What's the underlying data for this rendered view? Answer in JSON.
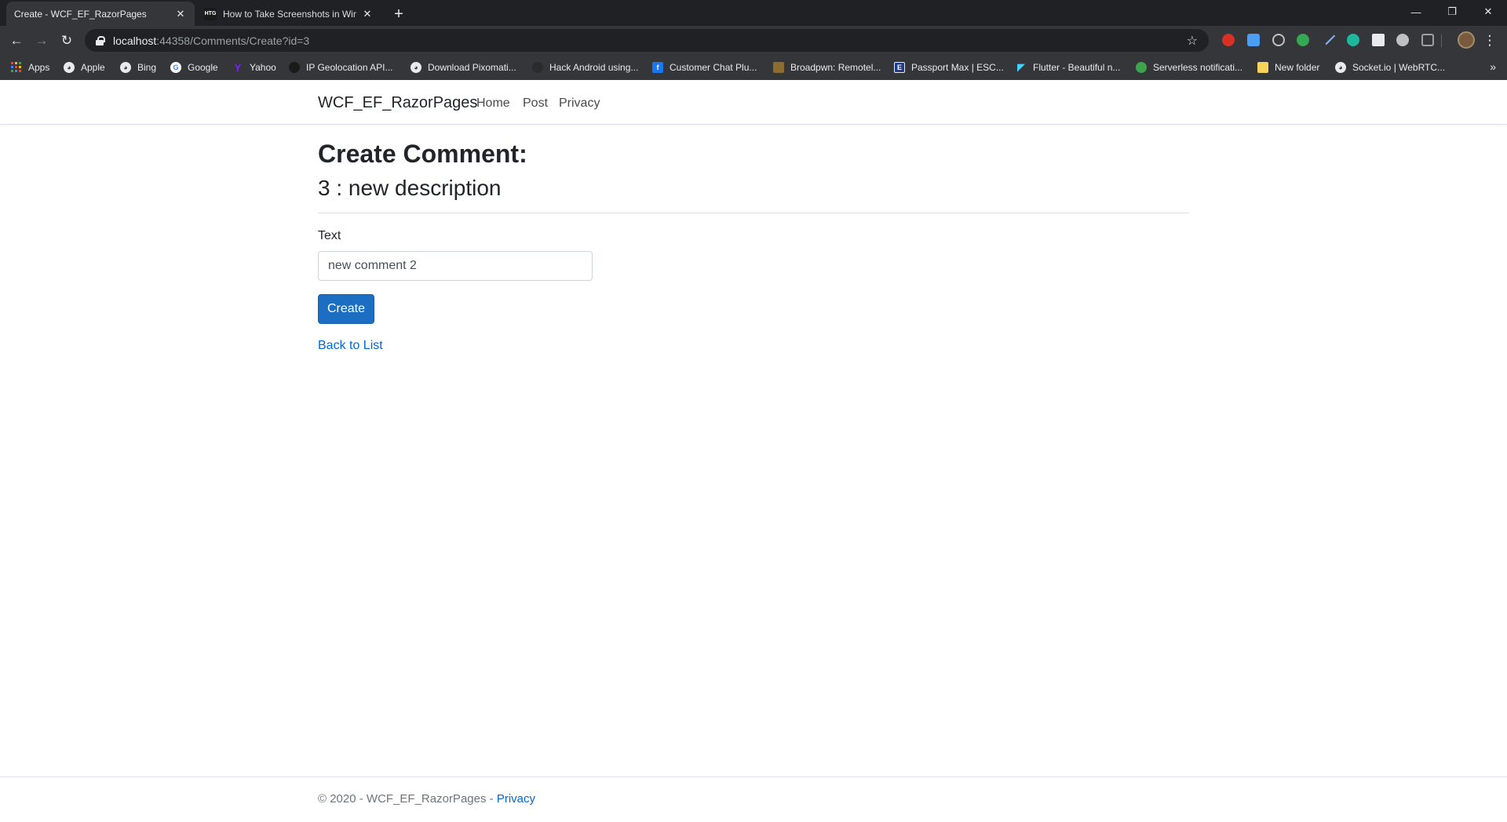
{
  "browser": {
    "tabs": [
      {
        "title": "Create - WCF_EF_RazorPages",
        "active": true,
        "favicon": "page-icon"
      },
      {
        "title": "How to Take Screenshots in Windo",
        "active": false,
        "favicon": "htg-icon",
        "favicon_text": "HTG"
      }
    ],
    "new_tab_label": "+",
    "window_controls": {
      "minimize": "—",
      "restore": "❐",
      "close": "✕"
    },
    "nav": {
      "back": "←",
      "forward": "→",
      "reload": "↻"
    },
    "url": {
      "host": "localhost",
      "rest": ":44358/Comments/Create?id=3"
    },
    "bookmark_star": "☆",
    "bookmarks": [
      {
        "label": "Apps",
        "icon": "apps-grid-icon"
      },
      {
        "label": "Apple",
        "icon": "globe-icon"
      },
      {
        "label": "Bing",
        "icon": "globe-icon"
      },
      {
        "label": "Google",
        "icon": "google-icon"
      },
      {
        "label": "Yahoo",
        "icon": "yahoo-icon"
      },
      {
        "label": "IP Geolocation API...",
        "icon": "geolocation-icon"
      },
      {
        "label": "Download Pixomati...",
        "icon": "globe-icon"
      },
      {
        "label": "Hack Android using...",
        "icon": "hack-icon"
      },
      {
        "label": "Customer Chat Plu...",
        "icon": "facebook-icon"
      },
      {
        "label": "Broadpwn: Remotel...",
        "icon": "broadpwn-icon"
      },
      {
        "label": "Passport Max | ESC...",
        "icon": "passport-icon"
      },
      {
        "label": "Flutter - Beautiful n...",
        "icon": "flutter-icon"
      },
      {
        "label": "Serverless notificati...",
        "icon": "serverless-icon"
      },
      {
        "label": "New folder",
        "icon": "folder-icon"
      },
      {
        "label": "Socket.io | WebRTC...",
        "icon": "globe-icon"
      }
    ],
    "bookmarks_more": "»",
    "colors": {
      "chrome_dark": "#202124",
      "chrome_toolbar": "#35363a",
      "text": "#e8eaed"
    }
  },
  "site": {
    "brand": "WCF_EF_RazorPages",
    "nav": [
      "Home",
      "Post",
      "Privacy"
    ]
  },
  "form": {
    "heading": "Create Comment:",
    "subheading": "3 : new description",
    "text_label": "Text",
    "text_value": "new comment 2",
    "submit_label": "Create",
    "back_link": "Back to List"
  },
  "footer": {
    "text": "© 2020 - WCF_EF_RazorPages - ",
    "privacy_link": "Privacy"
  },
  "colors": {
    "button_bg": "#1b6ec2",
    "link": "#0366d6",
    "text": "#212529",
    "muted": "#6c757d"
  }
}
